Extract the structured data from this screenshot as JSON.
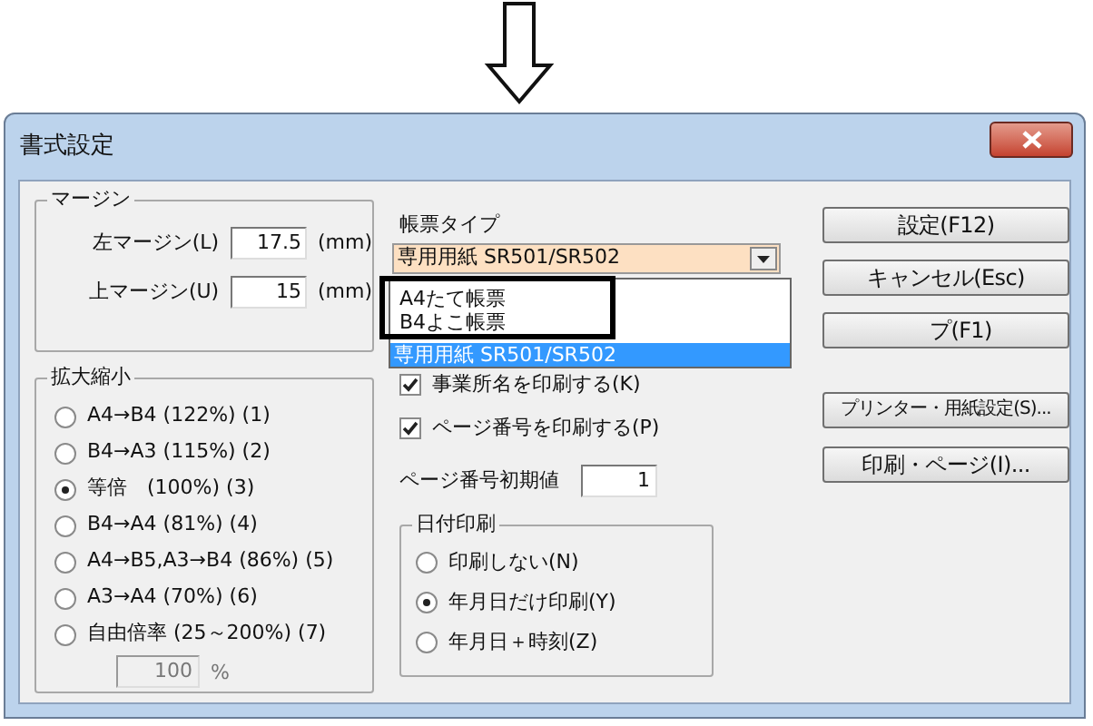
{
  "window": {
    "title": "書式設定"
  },
  "margin": {
    "title": "マージン",
    "fields": [
      {
        "label": "左マージン(L)",
        "value": "17.5",
        "unit": "(mm)"
      },
      {
        "label": "上マージン(U)",
        "value": "15",
        "unit": "(mm)"
      }
    ]
  },
  "scale": {
    "title": "拡大縮小",
    "options": [
      {
        "label": "A4→B4 (122%) (1)",
        "selected": false
      },
      {
        "label": "B4→A3 (115%) (2)",
        "selected": false
      },
      {
        "label": "等倍　(100%) (3)",
        "selected": true
      },
      {
        "label": "B4→A4 (81%) (4)",
        "selected": false
      },
      {
        "label": "A4→B5,A3→B4 (86%) (5)",
        "selected": false
      },
      {
        "label": "A3→A4 (70%) (6)",
        "selected": false
      },
      {
        "label": "自由倍率 (25～200%) (7)",
        "selected": false
      }
    ],
    "custom": {
      "value": "100",
      "unit": "%",
      "disabled": true
    }
  },
  "form_type": {
    "label": "帳票タイプ",
    "value": "専用用紙 SR501/SR502",
    "items": [
      {
        "label": "A4たて帳票",
        "selected": false
      },
      {
        "label": "B4よこ帳票",
        "selected": false
      },
      {
        "label": "専用用紙 SR501/SR502",
        "selected": true
      }
    ]
  },
  "checkboxes": [
    {
      "label": "事業所名を印刷する(K)",
      "checked": true
    },
    {
      "label": "ページ番号を印刷する(P)",
      "checked": true
    }
  ],
  "page_start": {
    "label": "ページ番号初期値",
    "value": "1"
  },
  "date_print": {
    "title": "日付印刷",
    "options": [
      {
        "label": "印刷しない(N)",
        "selected": false
      },
      {
        "label": "年月日だけ印刷(Y)",
        "selected": true
      },
      {
        "label": "年月日＋時刻(Z)",
        "selected": false
      }
    ]
  },
  "buttons": [
    {
      "label": "設定(F12)"
    },
    {
      "label": "キャンセル(Esc)"
    },
    {
      "label": "プ(F1)"
    },
    {
      "label": "プリンター・用紙設定(S)..."
    },
    {
      "label": "印刷・ページ(I)..."
    }
  ]
}
